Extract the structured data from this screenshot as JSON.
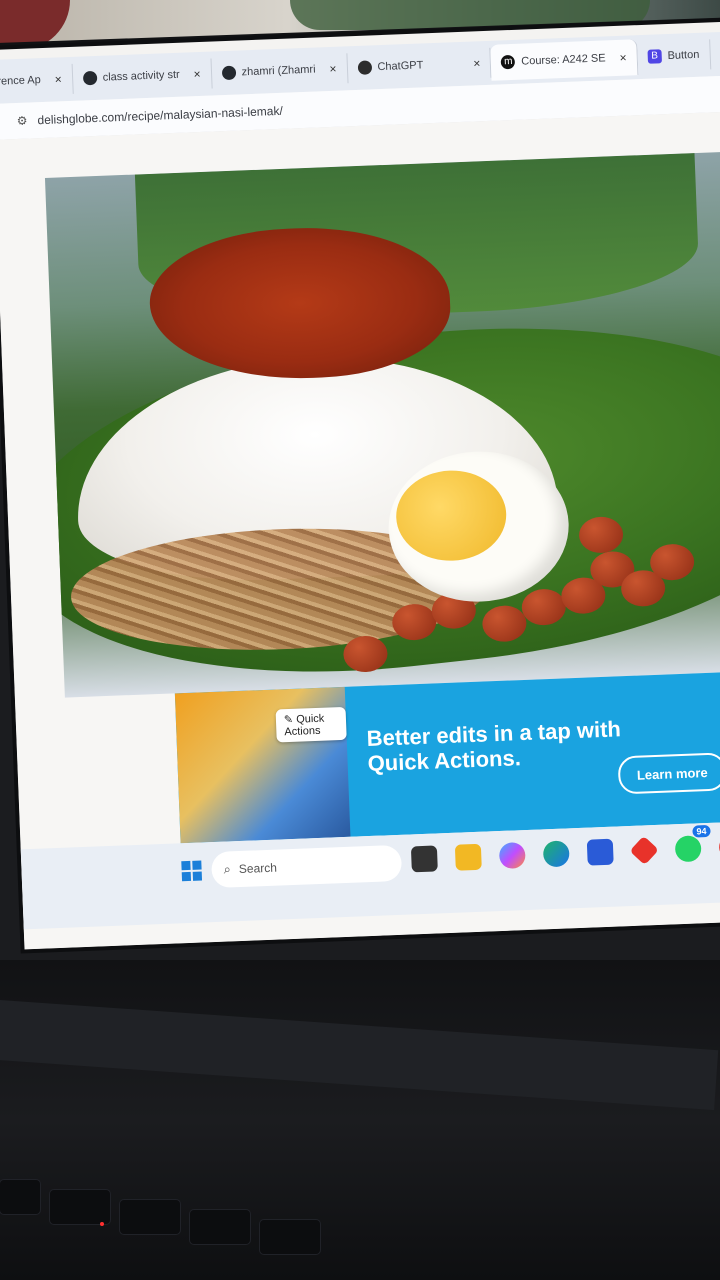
{
  "browser": {
    "tabs": [
      {
        "label": "erence Ap",
        "icon": "generic-icon"
      },
      {
        "label": "class activity str",
        "icon": "github-icon"
      },
      {
        "label": "zhamri (Zhamri",
        "icon": "github-icon"
      },
      {
        "label": "ChatGPT",
        "icon": "chatgpt-icon"
      },
      {
        "label": "Course: A242 SE",
        "icon": "m-icon",
        "icon_text": "m"
      },
      {
        "label": "Button",
        "icon": "b-icon",
        "icon_text": "B"
      }
    ],
    "url": "delishglobe.com/recipe/malaysian-nasi-lemak/",
    "tab_close_glyph": "×"
  },
  "ad": {
    "chip_label": "Quick Actions",
    "headline": "Better edits in a tap with Quick Actions.",
    "cta": "Learn more",
    "color": "#1aa3e0"
  },
  "taskbar": {
    "search_placeholder": "Search",
    "whatsapp_badge": "94",
    "apps": [
      "file-explorer-icon",
      "copilot-icon",
      "edge-icon",
      "store-icon",
      "app-icon",
      "whatsapp-icon",
      "wps-icon"
    ]
  }
}
